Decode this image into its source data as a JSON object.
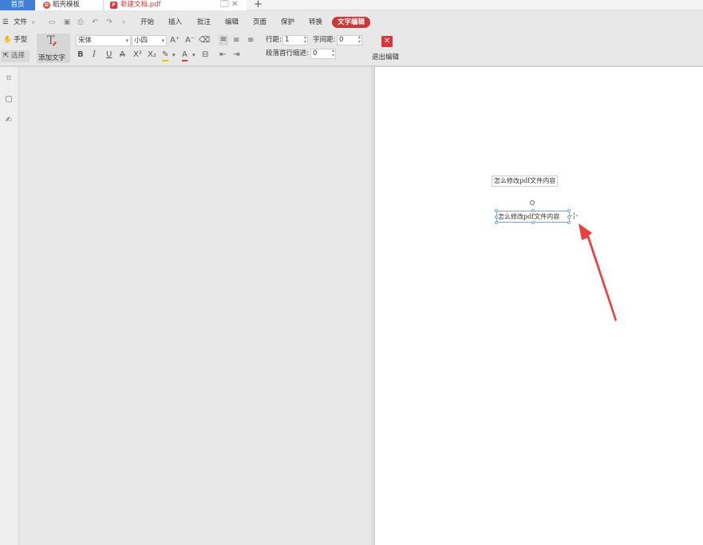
{
  "tabs": {
    "home": "首页",
    "template": "稻壳模板",
    "document": "新建文档.pdf",
    "template_icon": "daoke-logo-icon",
    "document_icon": "pdf-file-icon",
    "add_tab": "+"
  },
  "menu": {
    "file": "文件",
    "items": [
      "开始",
      "插入",
      "批注",
      "编辑",
      "页面",
      "保护",
      "转换"
    ],
    "active": "文字编辑"
  },
  "toolbar": {
    "hand": "手型",
    "select": "选择",
    "add_text": "添加文字",
    "font_name": "宋体",
    "font_size": "小四",
    "line_spacing_label": "行距:",
    "line_spacing_value": "1",
    "char_spacing_label": "字间距:",
    "char_spacing_value": "0",
    "indent_label": "段落首行缩进:",
    "indent_value": "0",
    "exit_label": "退出编辑"
  },
  "document": {
    "original_text": "怎么修改pdf文件内容",
    "edited_text": "怎么修改pdf文件内容"
  },
  "colors": {
    "accent_red": "#c9383a",
    "home_tab_blue": "#3f7fd8",
    "arrow_red": "#e8403a"
  }
}
